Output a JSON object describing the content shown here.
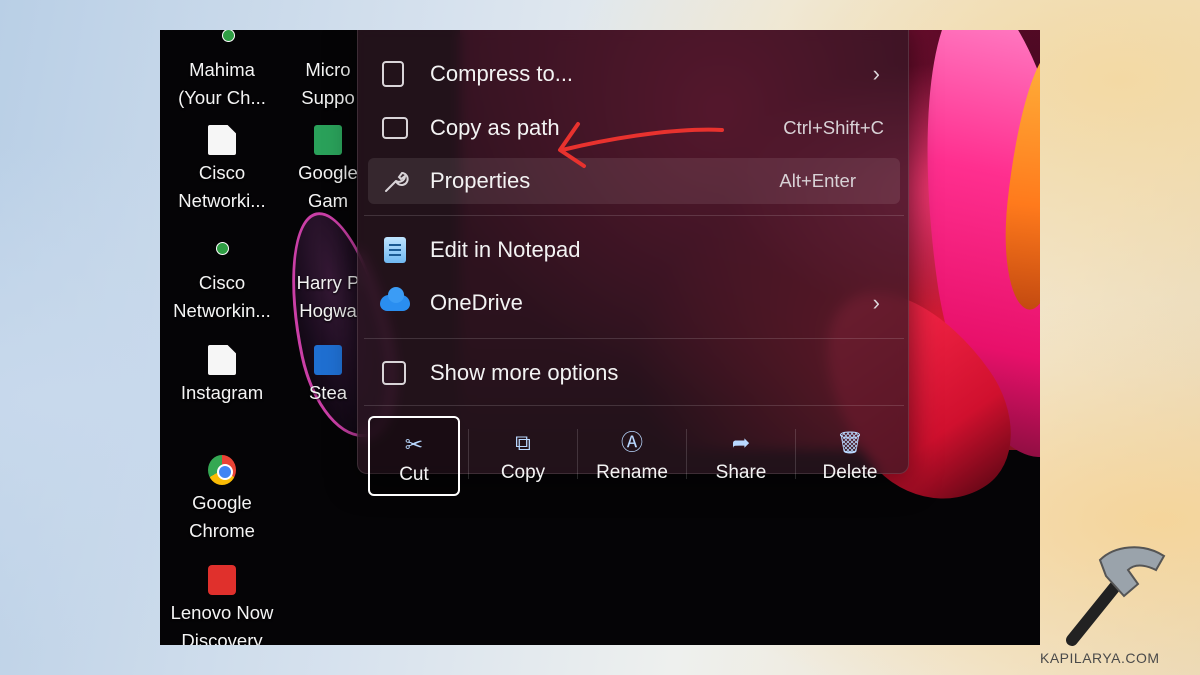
{
  "desktop_icons": [
    {
      "label": "Mahima\n(Your Ch...",
      "icon": "user-folder-icon"
    },
    {
      "label": "Micro\nSuppo",
      "icon": "file-icon"
    },
    {
      "label": "Cisco\nNetworki...",
      "icon": "file-icon"
    },
    {
      "label": "Google\nGam",
      "icon": "game-icon"
    },
    {
      "label": "Cisco\nNetworkin...",
      "icon": "file-icon"
    },
    {
      "label": "Harry P\nHogwa",
      "icon": "game-icon"
    },
    {
      "label": "Instagram",
      "icon": "file-icon"
    },
    {
      "label": "Stea",
      "icon": "steam-icon"
    },
    {
      "label": "Google\nChrome",
      "icon": "chrome-icon"
    },
    {
      "label": "Lenovo Now\nDiscovery",
      "icon": "lenovo-icon"
    }
  ],
  "context_menu": {
    "items": [
      {
        "label": "Compress to...",
        "icon": "zip-icon",
        "shortcut": "",
        "has_submenu": true
      },
      {
        "label": "Copy as path",
        "icon": "path-icon",
        "shortcut": "Ctrl+Shift+C",
        "has_submenu": false
      },
      {
        "label": "Properties",
        "icon": "wrench-icon",
        "shortcut": "Alt+Enter",
        "has_submenu": false,
        "highlighted": true
      },
      {
        "label": "Edit in Notepad",
        "icon": "notepad-icon",
        "shortcut": "",
        "has_submenu": false
      },
      {
        "label": "OneDrive",
        "icon": "onedrive-icon",
        "shortcut": "",
        "has_submenu": true
      },
      {
        "label": "Show more options",
        "icon": "open-external-icon",
        "shortcut": "",
        "has_submenu": false
      }
    ],
    "chevron": "›",
    "actions": [
      {
        "label": "Cut",
        "icon": "scissors-icon",
        "selected": true
      },
      {
        "label": "Copy",
        "icon": "copy-icon",
        "selected": false
      },
      {
        "label": "Rename",
        "icon": "rename-icon",
        "selected": false
      },
      {
        "label": "Share",
        "icon": "share-icon",
        "selected": false
      },
      {
        "label": "Delete",
        "icon": "trash-icon",
        "selected": false
      }
    ]
  },
  "annotation": {
    "color": "#e8322e"
  },
  "watermark": "KAPILARYA.COM"
}
